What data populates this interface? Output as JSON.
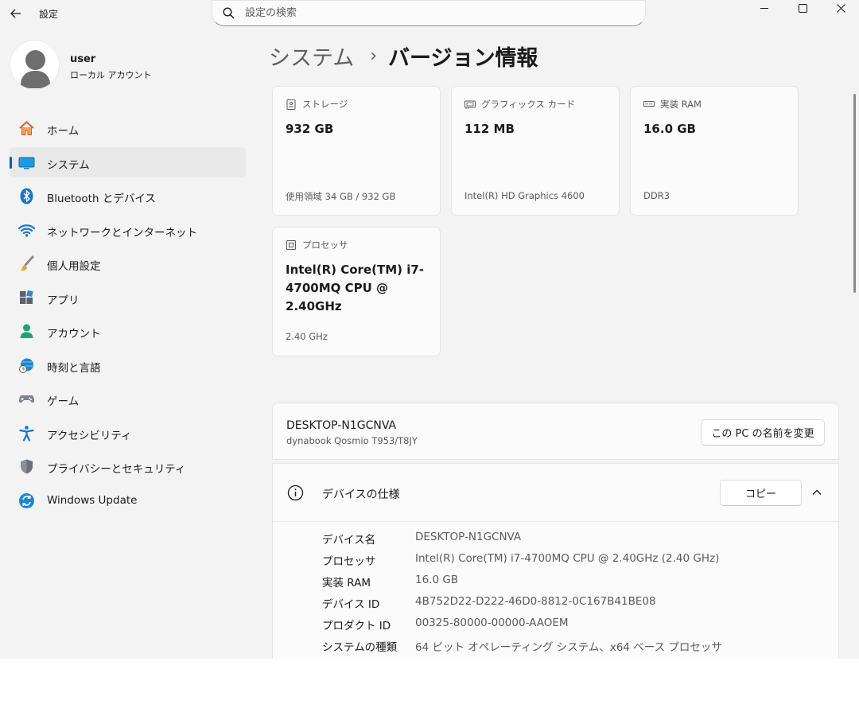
{
  "app": {
    "title": "設定",
    "window_controls": [
      "minimize-icon",
      "maximize-icon",
      "close-icon"
    ]
  },
  "search": {
    "placeholder": "設定の検索"
  },
  "profile": {
    "name": "user",
    "account_type": "ローカル アカウント"
  },
  "sidebar": {
    "items": [
      {
        "label": "ホーム",
        "icon": "home-icon"
      },
      {
        "label": "システム",
        "icon": "system-icon",
        "active": true
      },
      {
        "label": "Bluetooth とデバイス",
        "icon": "bluetooth-icon"
      },
      {
        "label": "ネットワークとインターネット",
        "icon": "wifi-icon"
      },
      {
        "label": "個人用設定",
        "icon": "brush-icon"
      },
      {
        "label": "アプリ",
        "icon": "apps-icon"
      },
      {
        "label": "アカウント",
        "icon": "account-icon"
      },
      {
        "label": "時刻と言語",
        "icon": "globe-clock-icon"
      },
      {
        "label": "ゲーム",
        "icon": "gamepad-icon"
      },
      {
        "label": "アクセシビリティ",
        "icon": "accessibility-icon"
      },
      {
        "label": "プライバシーとセキュリティ",
        "icon": "shield-icon"
      },
      {
        "label": "Windows Update",
        "icon": "windows-update-icon"
      }
    ]
  },
  "breadcrumb": {
    "parent": "システム",
    "separator": "›",
    "current": "バージョン情報"
  },
  "cards": {
    "storage": {
      "title": "ストレージ",
      "value": "932 GB",
      "sub": "使用領域 34 GB / 932 GB"
    },
    "graphics": {
      "title": "グラフィックス カード",
      "value": "112 MB",
      "sub": "Intel(R) HD Graphics 4600"
    },
    "ram": {
      "title": "実装 RAM",
      "value": "16.0 GB",
      "sub": "DDR3"
    },
    "processor": {
      "title": "プロセッサ",
      "value": "Intel(R) Core(TM) i7-4700MQ CPU @ 2.40GHz",
      "sub": "2.40 GHz"
    }
  },
  "device": {
    "name": "DESKTOP-N1GCNVA",
    "model": "dynabook Qosmio T953/T8JY",
    "rename_label": "この PC の名前を変更"
  },
  "specs": {
    "title": "デバイスの仕様",
    "copy_label": "コピー",
    "rows": [
      {
        "key": "デバイス名",
        "value": "DESKTOP-N1GCNVA"
      },
      {
        "key": "プロセッサ",
        "value": "Intel(R) Core(TM) i7-4700MQ CPU @ 2.40GHz (2.40 GHz)"
      },
      {
        "key": "実装 RAM",
        "value": "16.0 GB"
      },
      {
        "key": "デバイス ID",
        "value": "4B752D22-D222-46D0-8812-0C167B41BE08"
      },
      {
        "key": "プロダクト ID",
        "value": "00325-80000-00000-AAOEM"
      },
      {
        "key": "システムの種類",
        "value": "64 ビット オペレーティング システム、x64 ベース プロセッサ"
      }
    ]
  },
  "colors": {
    "accent": "#005fb8",
    "window_bg": "#f3f3f3",
    "card_bg": "#fbfbfb"
  }
}
